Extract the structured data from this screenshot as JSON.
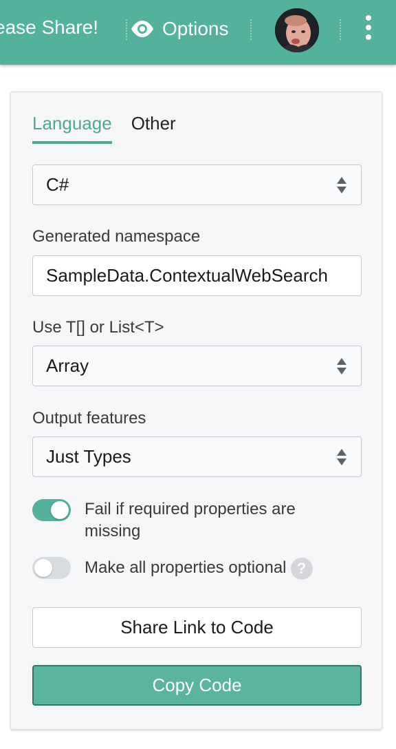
{
  "header": {
    "share_text": "ease Share!",
    "options_label": "Options",
    "options_icon": "eye-icon",
    "avatar_icon": "user-avatar",
    "menu_icon": "more-vertical-icon",
    "background_color": "#53b19d"
  },
  "tabs": [
    {
      "label": "Language",
      "active": true
    },
    {
      "label": "Other",
      "active": false
    }
  ],
  "language_select": {
    "value": "C#"
  },
  "namespace": {
    "label": "Generated namespace",
    "value": "SampleData.ContextualWebSearch"
  },
  "collection": {
    "label": "Use T[] or List<T>",
    "value": "Array"
  },
  "features": {
    "label": "Output features",
    "value": "Just Types"
  },
  "toggles": [
    {
      "label": "Fail if required properties are missing",
      "on": true
    },
    {
      "label": "Make all properties optional",
      "on": false,
      "help_icon": "?"
    }
  ],
  "buttons": {
    "share": "Share Link to Code",
    "copy": "Copy Code"
  },
  "colors": {
    "accent": "#53b19d",
    "accent_dark": "#2f7768"
  }
}
